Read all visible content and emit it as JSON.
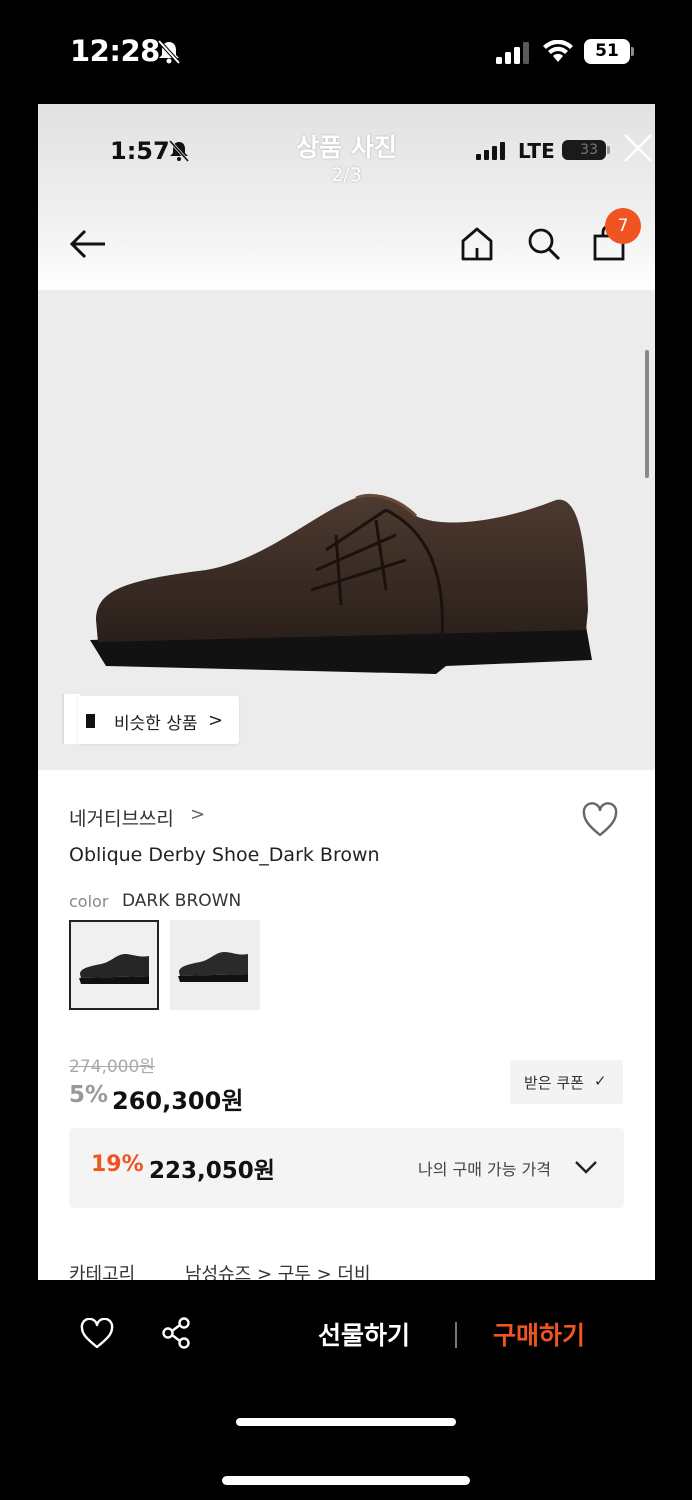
{
  "outer_status": {
    "time": "12:28",
    "battery": "51",
    "icons": [
      "bell-slash-icon",
      "signal-icon",
      "wifi-icon",
      "battery-icon"
    ]
  },
  "inner_status": {
    "time": "1:57",
    "network": "LTE",
    "battery": "33"
  },
  "viewer": {
    "title": "상품 사진",
    "counter": "2/3"
  },
  "nav": {
    "cart_badge": "7",
    "icons": [
      "back-arrow-icon",
      "home-icon",
      "search-icon",
      "shopping-bag-icon"
    ]
  },
  "gallery": {
    "similar_label": "비슷한 상품",
    "similar_chevron": ">"
  },
  "product": {
    "brand": "네거티브쓰리",
    "brand_chevron": ">",
    "name": "Oblique Derby Shoe_Dark Brown",
    "color_label": "color",
    "color_value": "DARK BROWN"
  },
  "price": {
    "original": "274,000원",
    "discount_rate": "5%",
    "sale": "260,300원",
    "coupon_label": "받은 쿠폰",
    "coupon_check": "✓",
    "my_rate": "19%",
    "my_price": "223,050원",
    "my_label": "나의 구매 가능 가격"
  },
  "category": {
    "label": "카테고리",
    "path": "남성슈즈 > 구두 > 더비"
  },
  "bottom_bar": {
    "gift_label": "선물하기",
    "buy_label": "구매하기"
  },
  "colors": {
    "accent": "#ef5421",
    "background": "#000000",
    "surface": "#ffffff"
  }
}
